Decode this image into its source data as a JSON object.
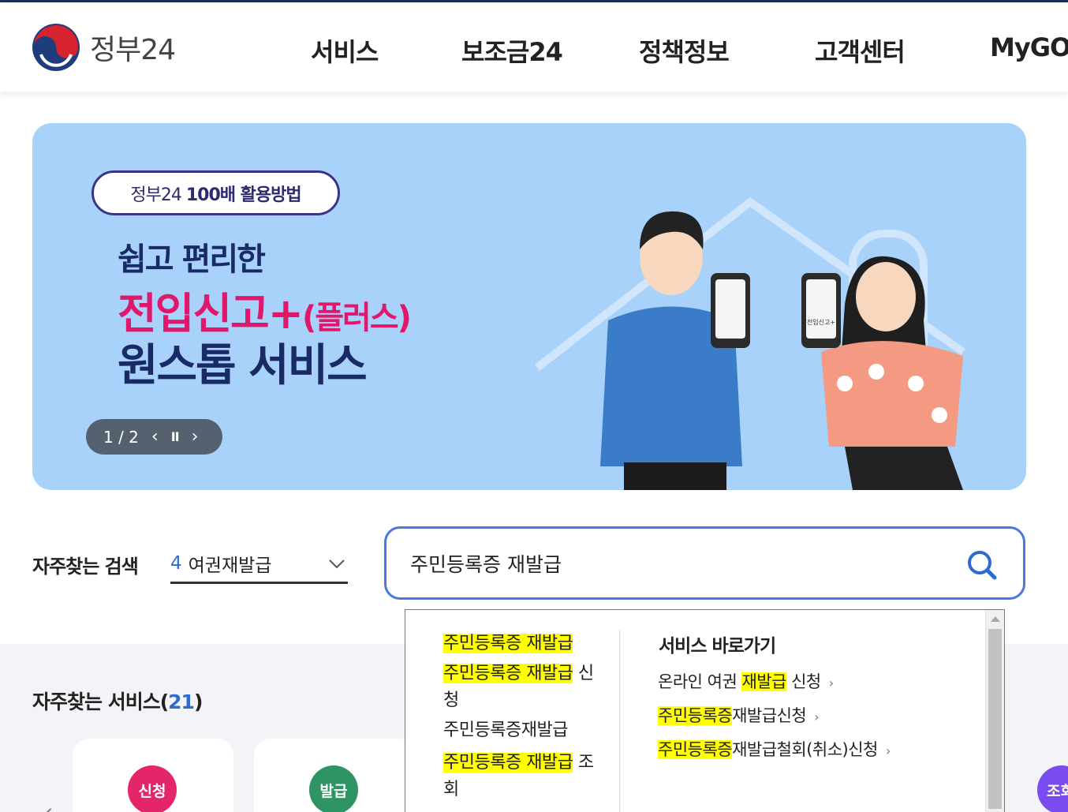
{
  "header": {
    "logo_text": "정부24",
    "nav": [
      "서비스",
      "보조금24",
      "정책정보",
      "고객센터",
      "MyGOV"
    ]
  },
  "banner": {
    "badge_prefix": "정부24",
    "badge_text": "100배 활용방법",
    "line1": "쉽고 편리한",
    "line2": "전입신고+",
    "line2_suffix": "(플러스)",
    "line3": "원스톱 서비스",
    "pager": "1 / 2",
    "phone_label": "전입신고+",
    "bg_color": "#a9d2fb",
    "accent_pink": "#e0186c",
    "accent_navy": "#1a2a66"
  },
  "search": {
    "trend_label": "자주찾는 검색",
    "trend_rank": "4",
    "trend_term": "여권재발급",
    "query": "주민등록증 재발급",
    "accent": "#4979dc"
  },
  "autocomplete": {
    "suggestions": [
      {
        "hl": "주민등록증 재발급",
        "rest": ""
      },
      {
        "hl": "주민등록증 재발급",
        "rest": " 신청"
      },
      {
        "hl": "",
        "rest": "주민등록증재발급"
      },
      {
        "hl": "주민등록증 재발급",
        "rest": " 조회"
      }
    ],
    "shortcut_title": "서비스 바로가기",
    "shortcuts": [
      {
        "pre": "온라인 여권 ",
        "hl": "재발급",
        "post": " 신청"
      },
      {
        "pre": "",
        "hl": "주민등록증",
        "post": "재발급신청"
      },
      {
        "pre": "",
        "hl": "주민등록증",
        "post": "재발급철회(취소)신청"
      }
    ]
  },
  "favorites": {
    "title": "자주찾는 서비스(",
    "count": "21",
    "title_end": ")",
    "cards": [
      {
        "badge": "신청",
        "color": "#e5256a"
      },
      {
        "badge": "발급",
        "color": "#2f9464"
      }
    ],
    "side_badge": "조회",
    "side_color": "#7a4cf0"
  }
}
